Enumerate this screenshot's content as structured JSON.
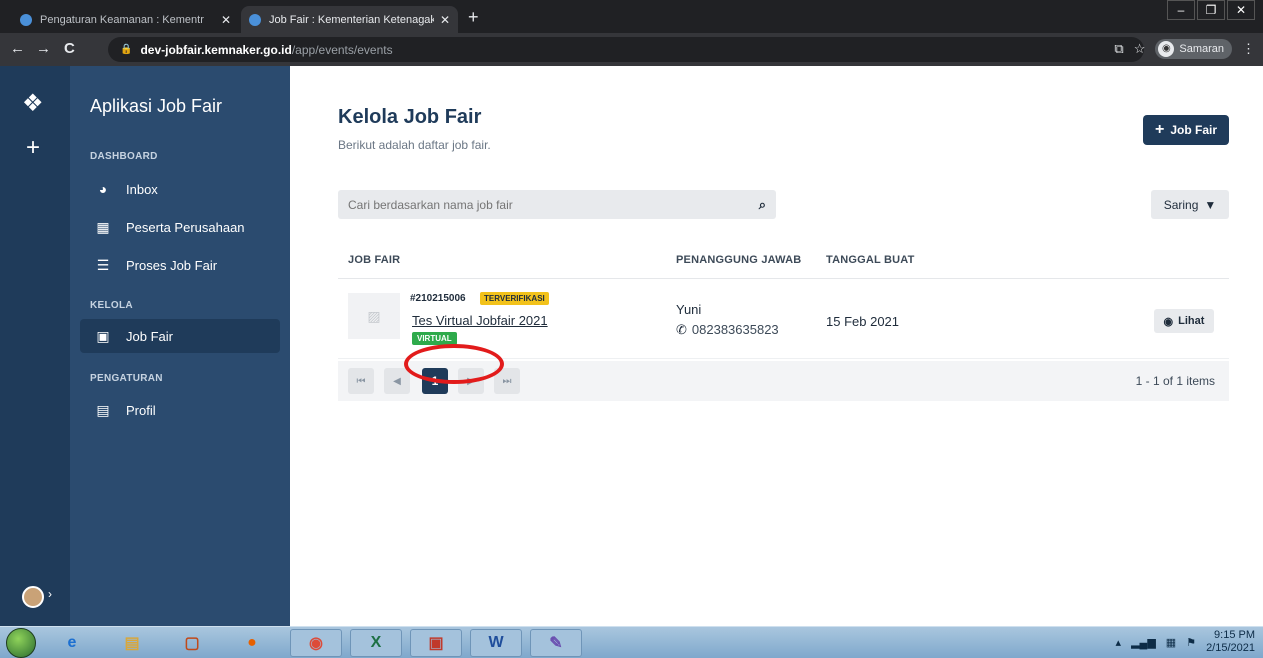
{
  "browser": {
    "tabs": [
      {
        "title": "Pengaturan Keamanan : Kementr",
        "close": "✕"
      },
      {
        "title": "Job Fair : Kementerian Ketenagak",
        "close": "✕"
      }
    ],
    "new_tab": "+",
    "url_domain": "dev-jobfair.kemnaker.go.id",
    "url_path": "/app/events/events",
    "profile_label": "Samaran"
  },
  "rail": {
    "logo_glyph": "❖",
    "add_glyph": "+"
  },
  "sidebar": {
    "app_title": "Aplikasi Job Fair",
    "sections": {
      "dashboard": "DASHBOARD",
      "kelola": "KELOLA",
      "pengaturan": "PENGATURAN"
    },
    "items": [
      {
        "label": "Inbox",
        "icon": "pie-chart-icon"
      },
      {
        "label": "Peserta Perusahaan",
        "icon": "building-icon"
      },
      {
        "label": "Proses Job Fair",
        "icon": "task-list-icon"
      },
      {
        "label": "Job Fair",
        "icon": "calendar-icon",
        "active": true
      },
      {
        "label": "Profil",
        "icon": "id-card-icon"
      }
    ]
  },
  "main": {
    "title": "Kelola Job Fair",
    "subtitle": "Berikut adalah daftar job fair.",
    "add_button": "Job Fair",
    "search_placeholder": "Cari berdasarkan nama job fair",
    "filter_button": "Saring",
    "table": {
      "headers": [
        "JOB FAIR",
        "PENANGGUNG JAWAB",
        "TANGGAL BUAT"
      ],
      "rows": [
        {
          "id": "#210215006",
          "status": "TERVERIFIKASI",
          "name": "Tes Virtual Jobfair 2021",
          "type": "VIRTUAL",
          "pic_name": "Yuni",
          "pic_phone": "082383635823",
          "created": "15 Feb 2021",
          "action": "Lihat"
        }
      ]
    },
    "pagination": {
      "first": "⏮",
      "prev": "◀",
      "current": "1",
      "next": "▶",
      "last": "⏭",
      "info": "1 - 1 of 1 items"
    }
  },
  "taskbar": {
    "time": "9:15 PM",
    "date": "2/15/2021"
  },
  "colors": {
    "navy": "#1f3b5a",
    "sidebar": "#2b4b6f",
    "verified": "#f2c21b",
    "virtual": "#2eaa4b",
    "annotation": "#e21b1b"
  }
}
